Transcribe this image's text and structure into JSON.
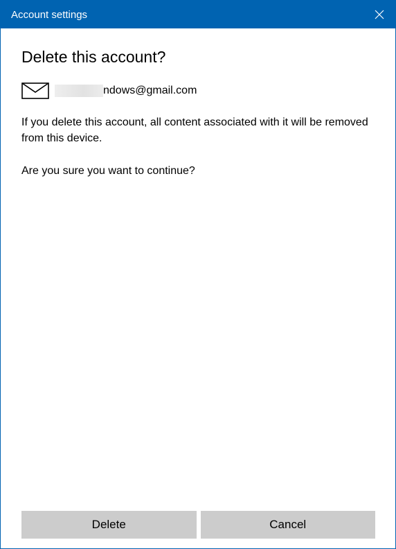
{
  "window": {
    "title": "Account settings"
  },
  "dialog": {
    "heading": "Delete this account?",
    "account_email_visible": "ndows@gmail.com",
    "message": "If you delete this account, all content associated with it will be removed from this device.",
    "question": "Are you sure you want to continue?"
  },
  "buttons": {
    "delete_label": "Delete",
    "cancel_label": "Cancel"
  },
  "icons": {
    "close": "close-icon",
    "mail": "mail-icon"
  },
  "colors": {
    "titlebar": "#0063b1",
    "button_bg": "#cccccc"
  }
}
